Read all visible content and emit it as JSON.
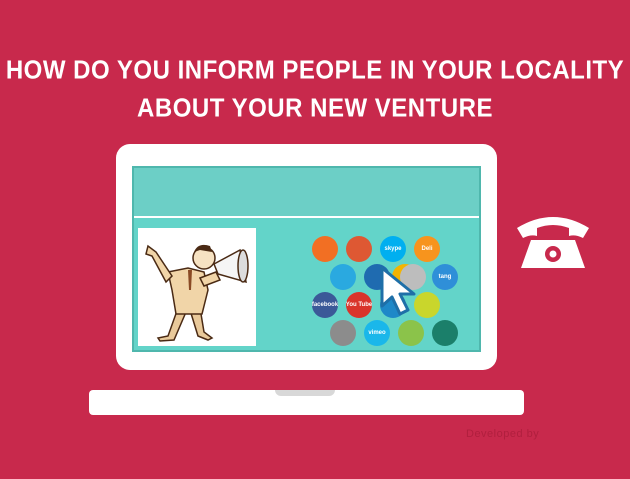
{
  "title": {
    "line1": "HOW DO YOU INFORM PEOPLE IN  YOUR  LOCALITY",
    "line2": "ABOUT YOUR NEW VENTURE"
  },
  "watermark": "Developed by",
  "social_icons": [
    {
      "name": "soundcloud-icon",
      "label": "",
      "color": "#f26f23"
    },
    {
      "name": "duckduckgo-icon",
      "label": "",
      "color": "#de5833"
    },
    {
      "name": "skype-icon",
      "label": "skype",
      "color": "#00aff0"
    },
    {
      "name": "delicious-icon",
      "label": "Deli",
      "color": "#f7941d"
    },
    {
      "name": "twitter-icon",
      "label": "",
      "color": "#2aa9e0"
    },
    {
      "name": "bookmark-icon",
      "label": "",
      "color": "#1f6bb0"
    },
    {
      "name": "orange-app-icon",
      "label": "",
      "color": "#f4b400"
    },
    {
      "name": "plain-app-icon",
      "label": "",
      "color": "#bdbdbd"
    },
    {
      "name": "tango-icon",
      "label": "tang",
      "color": "#2f8fd8"
    },
    {
      "name": "facebook-icon",
      "label": "facebook",
      "color": "#3b5998"
    },
    {
      "name": "youtube-icon",
      "label": "You Tube",
      "color": "#d9342b"
    },
    {
      "name": "blue-app-icon",
      "label": "",
      "color": "#1e88c8"
    },
    {
      "name": "yellow-app-icon",
      "label": "",
      "color": "#c9d62c"
    },
    {
      "name": "gray-app-icon",
      "label": "",
      "color": "#8c8c8c"
    },
    {
      "name": "vimeo-icon",
      "label": "vimeo",
      "color": "#1ab7ea"
    },
    {
      "name": "android-icon",
      "label": "",
      "color": "#8bc34a"
    },
    {
      "name": "headphones-icon",
      "label": "",
      "color": "#1b7f6a"
    }
  ]
}
